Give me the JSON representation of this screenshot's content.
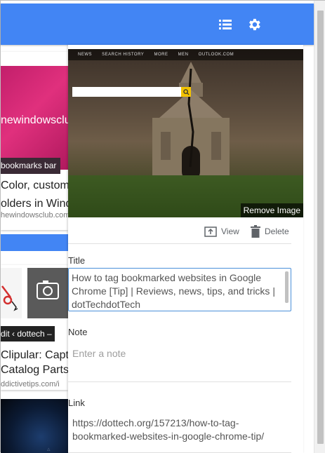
{
  "toolbar": {
    "list_icon": "list-view-icon",
    "settings_icon": "gear-icon"
  },
  "background_cards": [
    {
      "thumb_text": "newindowsclub",
      "tag": "bookmarks bar",
      "title_lines": [
        "Color, customi",
        "olders in Wind"
      ],
      "url": "hewindowsclub.com"
    },
    {
      "tag": "dit ‹ dottech –",
      "title_lines": [
        "Clipular: Captu",
        "Catalog Parts C"
      ],
      "url": "ddictivetips.com/i"
    }
  ],
  "detail": {
    "image": {
      "nav_items": [
        "NEWS",
        "SEARCH HISTORY",
        "MORE",
        "MEN",
        "OUTLOOK.COM"
      ],
      "remove_label": "Remove Image"
    },
    "actions": {
      "view_label": "View",
      "delete_label": "Delete"
    },
    "title": {
      "label": "Title",
      "value": "How to tag bookmarked websites in Google Chrome [Tip] | Reviews, news, tips, and tricks | dotTechdotTech"
    },
    "note": {
      "label": "Note",
      "placeholder": "Enter a note",
      "value": ""
    },
    "link": {
      "label": "Link",
      "value": "https://dottech.org/157213/how-to-tag-bookmarked-websites-in-google-chrome-tip/"
    }
  },
  "colors": {
    "toolbar_blue": "#4285f4",
    "focus_border": "#4a90d9"
  }
}
